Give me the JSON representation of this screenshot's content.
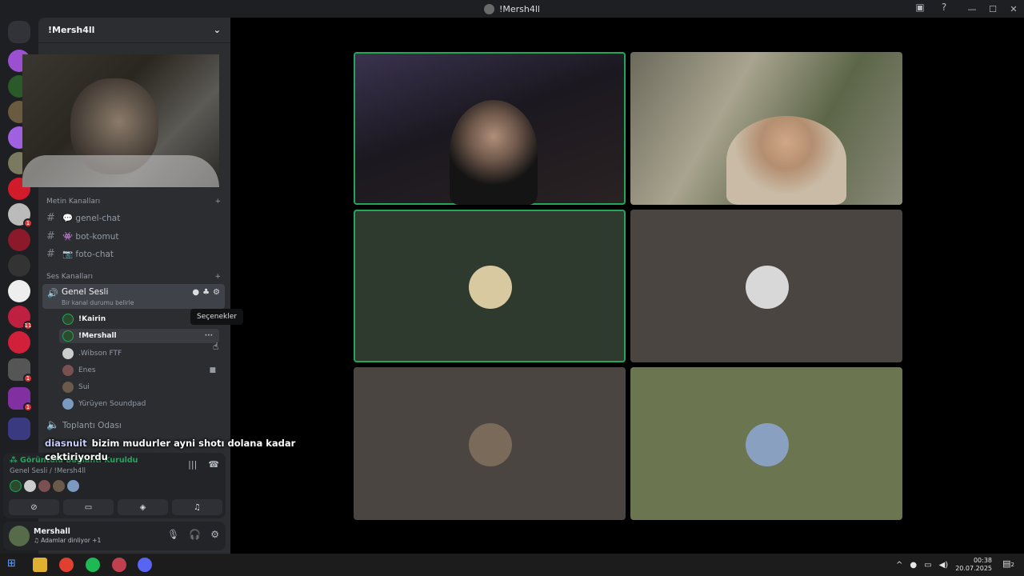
{
  "window": {
    "title": "!Mersh4ll"
  },
  "guild": {
    "name": "!Mersh4ll"
  },
  "categories": {
    "text": "Metin Kanalları",
    "voice": "Ses Kanalları"
  },
  "text_channels": [
    "💬 genel-chat",
    "👾 bot-komut",
    "📷 foto-chat"
  ],
  "voice_channel": {
    "name": "Genel Sesli",
    "status": "Bir kanal durumu belirle"
  },
  "members": [
    "!Kairin",
    "!Mershall",
    ".Wibson FTF",
    "Enes",
    "Sui",
    "Yürüyen Soundpad"
  ],
  "other_voice": "Toplantı Odası",
  "tooltip": "Seçenekler",
  "caption": {
    "who": "diasnuit",
    "text": "bizim mudurler ayni shotı dolana kadar cektiriyordu"
  },
  "voice_panel": {
    "status": "Görüntülü Bağlantı Kuruldu",
    "location": "Genel Sesli / !Mersh4ll"
  },
  "user": {
    "name": "Mershall",
    "activity": "Adamlar dinliyor +1"
  },
  "taskbar": {
    "time": "00:38",
    "date": "20.07.2025",
    "notif_count": "2"
  },
  "badges": [
    "1",
    "1",
    "11",
    "1",
    "1"
  ],
  "colors": {
    "speaking": "#23a55a",
    "tile_green": "#2f3a2e",
    "tile_brown": "#4a4540",
    "tile_olive": "#6b7550"
  }
}
